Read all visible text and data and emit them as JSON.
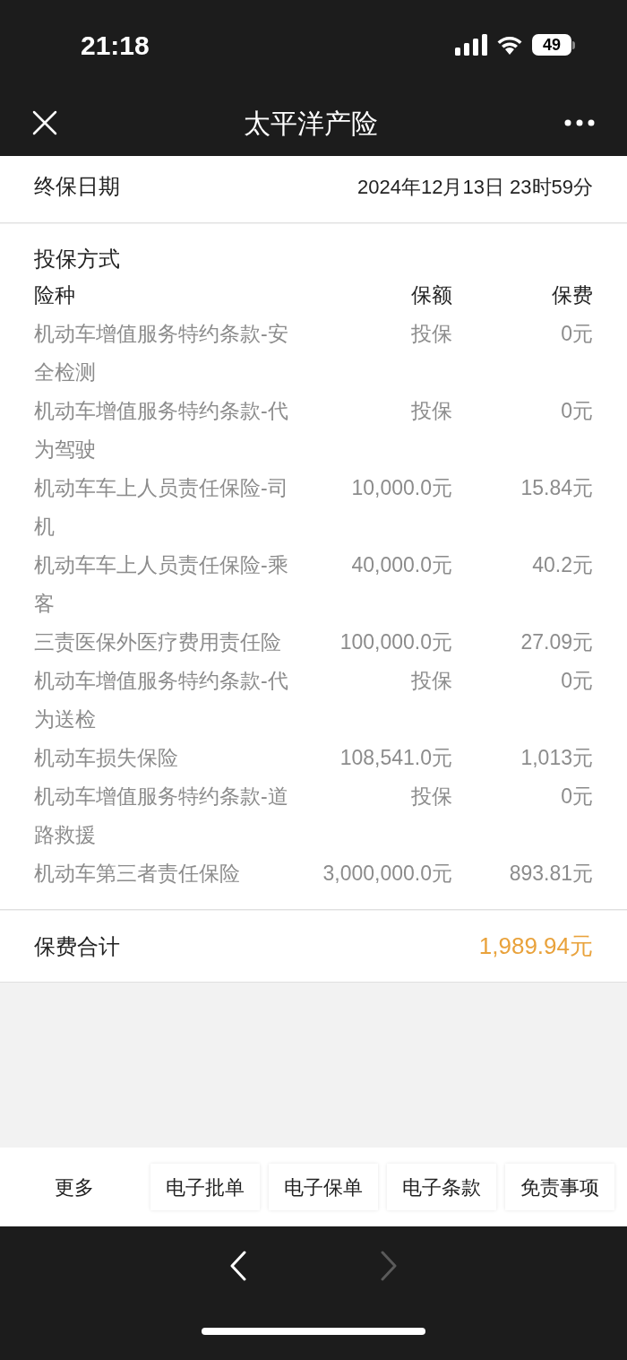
{
  "status_bar": {
    "time": "21:18",
    "battery": "49"
  },
  "nav_bar": {
    "title": "太平洋产险"
  },
  "end_date": {
    "label": "终保日期",
    "value": "2024年12月13日 23时59分"
  },
  "coverage": {
    "title": "投保方式",
    "columns": [
      "险种",
      "保额",
      "保费"
    ],
    "rows": [
      {
        "name": "机动车增值服务特约条款-安全检测",
        "amount": "投保",
        "premium": "0元"
      },
      {
        "name": "机动车增值服务特约条款-代为驾驶",
        "amount": "投保",
        "premium": "0元"
      },
      {
        "name": "机动车车上人员责任保险-司机",
        "amount": "10,000.0元",
        "premium": "15.84元"
      },
      {
        "name": "机动车车上人员责任保险-乘客",
        "amount": "40,000.0元",
        "premium": "40.2元"
      },
      {
        "name": "三责医保外医疗费用责任险",
        "amount": "100,000.0元",
        "premium": "27.09元"
      },
      {
        "name": "机动车增值服务特约条款-代为送检",
        "amount": "投保",
        "premium": "0元"
      },
      {
        "name": "机动车损失保险",
        "amount": "108,541.0元",
        "premium": "1,013元"
      },
      {
        "name": "机动车增值服务特约条款-道路救援",
        "amount": "投保",
        "premium": "0元"
      },
      {
        "name": "机动车第三者责任保险",
        "amount": "3,000,000.0元",
        "premium": "893.81元"
      }
    ]
  },
  "total": {
    "label": "保费合计",
    "value": "1,989.94元"
  },
  "toolbar": [
    "更多",
    "电子批单",
    "电子保单",
    "电子条款",
    "免责事项"
  ],
  "browser_nav": {
    "back": {
      "disabled": false
    },
    "forward": {
      "disabled": true
    }
  }
}
